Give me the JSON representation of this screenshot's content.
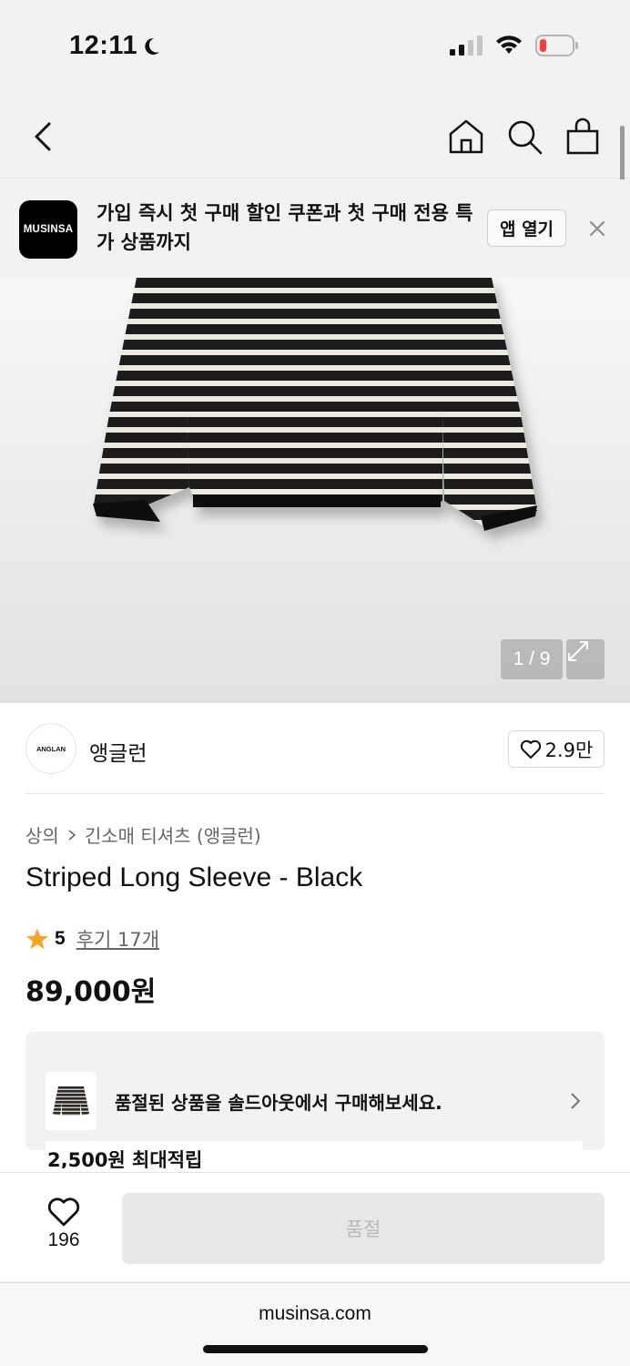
{
  "status_bar": {
    "time": "12:11",
    "battery_color": "#ff3b30"
  },
  "nav": {
    "icons": [
      "back-icon",
      "home-icon",
      "search-icon",
      "bag-icon"
    ]
  },
  "banner": {
    "logo_text": "MUSINSA",
    "message": "가입 즉시 첫 구매 할인 쿠폰과 첫 구매 전용 특가 상품까지",
    "open_label": "앱 열기"
  },
  "gallery": {
    "counter": "1 / 9"
  },
  "brand": {
    "logo_text": "ANGLAN",
    "name": "앵글런",
    "likes": "2.9만"
  },
  "breadcrumb": {
    "items": [
      "상의",
      "긴소매 티셔츠 (앵글런)"
    ]
  },
  "product": {
    "title": "Striped Long Sleeve - Black",
    "rating": "5",
    "reviews": "후기 17개",
    "price": "89,000원"
  },
  "soldout": {
    "message": "품절된 상품을 솔드아웃에서 구매해보세요.",
    "cut_text": "2,500원 최대적립"
  },
  "bottom": {
    "wish_count": "196",
    "buy_label": "품절"
  },
  "browser": {
    "url": "musinsa.com"
  },
  "colors": {
    "accent_star": "#f5a623",
    "text": "#111111"
  }
}
